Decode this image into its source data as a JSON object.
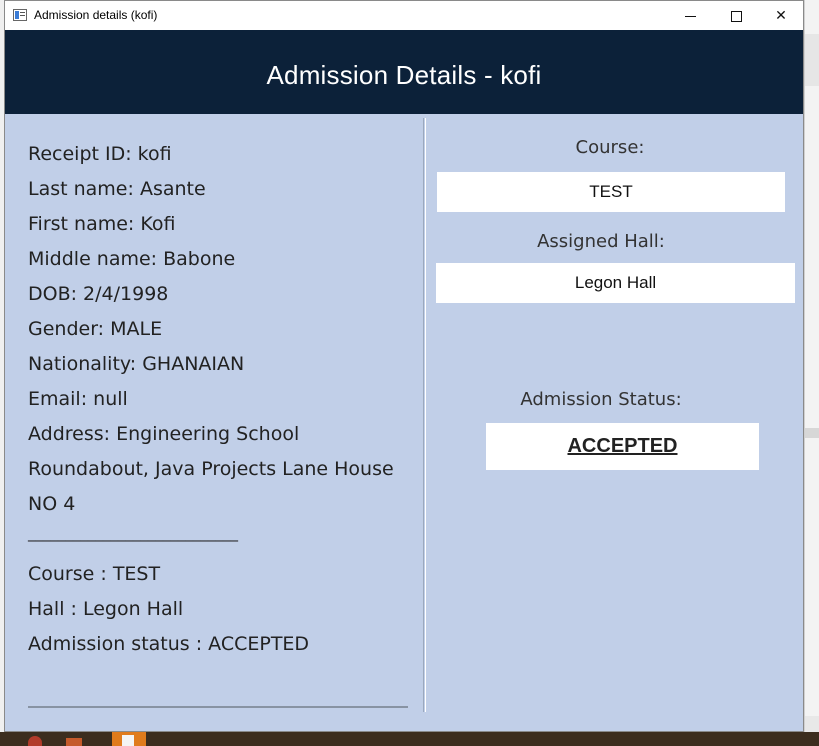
{
  "window": {
    "title": "Admission details (kofi)"
  },
  "header": {
    "title": "Admission Details - kofi"
  },
  "info": {
    "lines": [
      "Receipt ID: kofi",
      "Last name: Asante",
      "First name: Kofi",
      "Middle name: Babone",
      "DOB: 2/4/1998",
      "Gender: MALE",
      "Nationality: GHANAIAN",
      "Email: null",
      "Address: Engineering School",
      "Roundabout, Java Projects Lane House",
      "NO 4",
      "____________________________",
      "Course : TEST",
      "Hall : Legon Hall",
      "Admission status : ACCEPTED"
    ]
  },
  "course": {
    "label": "Course:",
    "value": "TEST"
  },
  "hall": {
    "label": "Assigned Hall:",
    "value": "Legon Hall"
  },
  "status": {
    "label": "Admission Status:",
    "value": "ACCEPTED"
  },
  "colors": {
    "header_bg": "#0c2139",
    "panel_bg": "#c1cfe8"
  },
  "icons": {
    "app": "java-app-icon",
    "minimize": "minimize-icon",
    "maximize": "maximize-icon",
    "close": "close-icon"
  }
}
